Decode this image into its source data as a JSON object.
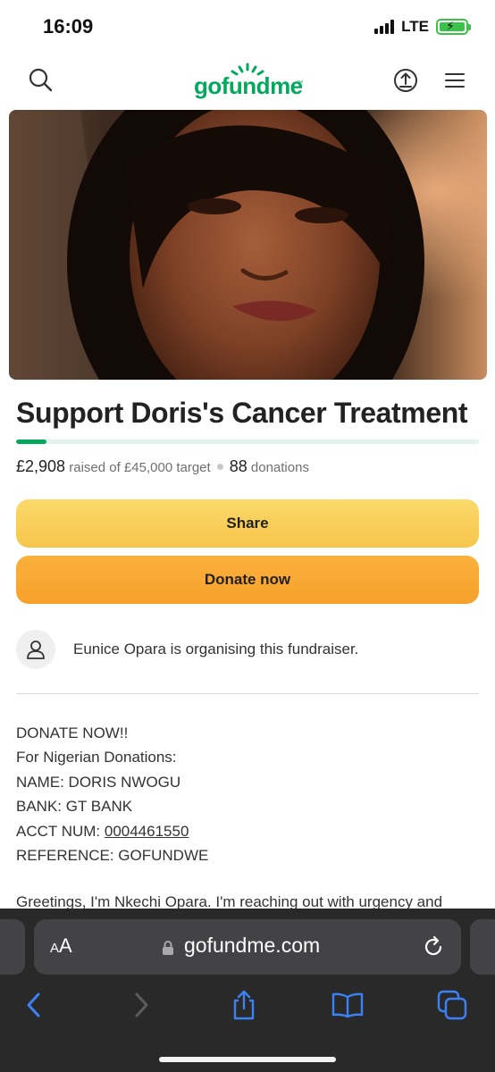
{
  "status_bar": {
    "time": "16:09",
    "network": "LTE",
    "icons": [
      "signal-icon",
      "battery-charging-icon"
    ]
  },
  "header": {
    "logo": "gofundme",
    "icons": [
      "search-icon",
      "share-upload-icon",
      "menu-icon"
    ],
    "brand_color": "#02a95c"
  },
  "campaign": {
    "title": "Support Doris's Cancer Treatment",
    "raised": "£2,908",
    "raised_suffix": "raised of £45,000 target",
    "donations_count": "88",
    "donations_label": "donations",
    "progress_fraction": 0.065
  },
  "buttons": {
    "share": "Share",
    "donate": "Donate now"
  },
  "organiser": {
    "text": "Eunice Opara is organising this fundraiser."
  },
  "story": {
    "line1": "DONATE NOW!!",
    "line2": "For Nigerian Donations:",
    "line3": "NAME: DORIS NWOGU",
    "line4": "BANK: GT BANK",
    "acct_label": "ACCT NUM: ",
    "acct_number": "0004461550",
    "line6": "REFERENCE: GOFUNDWE",
    "greeting": "Greetings, I'm Nkechi Opara. I'm reaching out with urgency and"
  },
  "browser": {
    "aa_label_small": "A",
    "aa_label_big": "A",
    "url": "gofundme.com",
    "icons": [
      "lock-icon",
      "reload-icon",
      "back-icon",
      "forward-icon",
      "share-icon",
      "bookmarks-icon",
      "tabs-icon"
    ]
  }
}
